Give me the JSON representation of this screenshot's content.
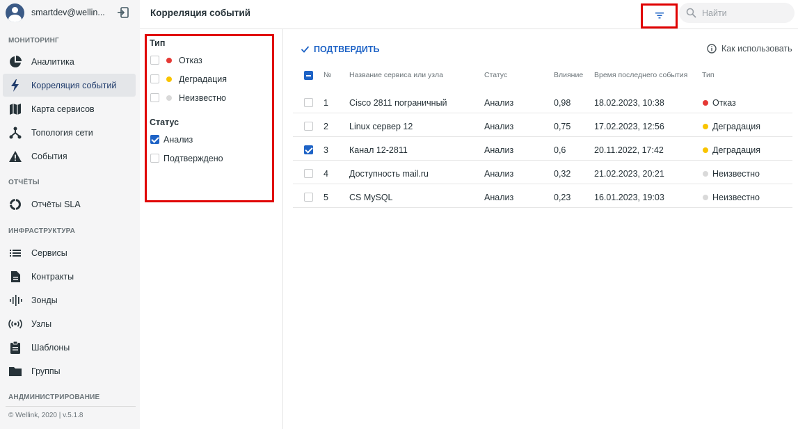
{
  "user": {
    "email": "smartdev@wellin..."
  },
  "sidebar": {
    "sections": {
      "monitoring": "МОНИТОРИНГ",
      "reports": "ОТЧЁТЫ",
      "infrastructure": "ИНФРАСТРУКТУРА",
      "administration": "АНДМИНИСТРИРОВАНИЕ"
    },
    "items": {
      "analytics": "Аналитика",
      "correlation": "Корреляция событий",
      "service_map": "Карта сервисов",
      "topology": "Топология сети",
      "events": "События",
      "sla_reports": "Отчёты SLA",
      "services": "Сервисы",
      "contracts": "Контракты",
      "probes": "Зонды",
      "nodes": "Узлы",
      "templates": "Шаблоны",
      "groups": "Группы"
    },
    "footer": "© Wellink, 2020 | v.5.1.8"
  },
  "header": {
    "title": "Корреляция событий",
    "search_placeholder": "Найти"
  },
  "filter": {
    "type_title": "Тип",
    "type_options": [
      "Отказ",
      "Деградация",
      "Неизвестно"
    ],
    "status_title": "Статус",
    "status_options": [
      "Анализ",
      "Подтверждено"
    ],
    "status_checked": [
      "Анализ"
    ]
  },
  "toolbar": {
    "confirm_label": "ПОДТВЕРДИТЬ",
    "howto_label": "Как использовать"
  },
  "table": {
    "headers": {
      "num": "№",
      "name": "Название сервиса или узла",
      "status": "Статус",
      "impact": "Влияние",
      "last_event": "Время последнего события",
      "type": "Тип"
    },
    "rows": [
      {
        "num": "1",
        "name": "Cisco 2811 пограничный",
        "status": "Анализ",
        "impact": "0,98",
        "time": "18.02.2023, 10:38",
        "type": "Отказ",
        "checked": false
      },
      {
        "num": "2",
        "name": "Linux сервер 12",
        "status": "Анализ",
        "impact": "0,75",
        "time": "17.02.2023, 12:56",
        "type": "Деградация",
        "checked": false
      },
      {
        "num": "3",
        "name": "Канал 12-2811",
        "status": "Анализ",
        "impact": "0,6",
        "time": "20.11.2022, 17:42",
        "type": "Деградация",
        "checked": true
      },
      {
        "num": "4",
        "name": "Доступность mail.ru",
        "status": "Анализ",
        "impact": "0,32",
        "time": "21.02.2023, 20:21",
        "type": "Неизвестно",
        "checked": false
      },
      {
        "num": "5",
        "name": "CS MySQL",
        "status": "Анализ",
        "impact": "0,23",
        "time": "16.01.2023, 19:03",
        "type": "Неизвестно",
        "checked": false
      }
    ]
  },
  "colors": {
    "accent": "#1e63c6",
    "failure": "#e53935",
    "degradation": "#f9c400",
    "unknown": "#d9d9d9",
    "highlight": "#e00000"
  }
}
